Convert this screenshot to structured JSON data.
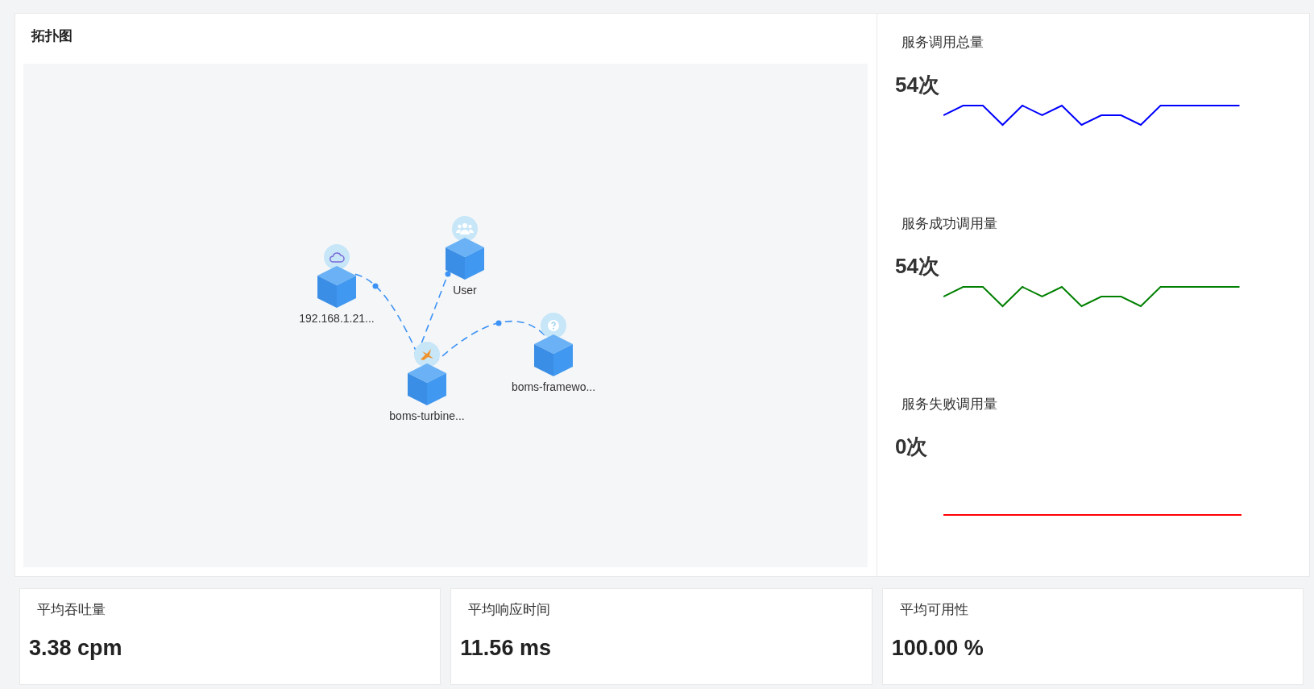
{
  "topology": {
    "title": "拓扑图",
    "nodes": [
      {
        "label": "192.168.1.21...",
        "kind": "cloud"
      },
      {
        "label": "User",
        "kind": "users"
      },
      {
        "label": "boms-turbine...",
        "kind": "service"
      },
      {
        "label": "boms-framewo...",
        "kind": "unknown"
      }
    ]
  },
  "stats": [
    {
      "label": "服务调用总量",
      "value": "54次",
      "color": "#0000ff",
      "kind": "zigzag"
    },
    {
      "label": "服务成功调用量",
      "value": "54次",
      "color": "#008000",
      "kind": "zigzag"
    },
    {
      "label": "服务失败调用量",
      "value": "0次",
      "color": "#ff0000",
      "kind": "flat"
    }
  ],
  "metrics": [
    {
      "label": "平均吞吐量",
      "value": "3.38 cpm"
    },
    {
      "label": "平均响应时间",
      "value": "11.56 ms"
    },
    {
      "label": "平均可用性",
      "value": "100.00 %"
    }
  ]
}
